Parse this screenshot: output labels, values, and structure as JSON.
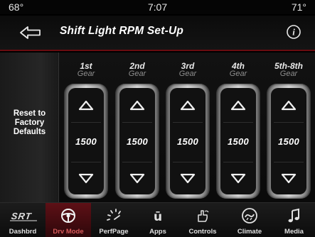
{
  "status": {
    "temp_left": "68°",
    "time": "7:07",
    "temp_right": "71°"
  },
  "header": {
    "title": "Shift Light RPM Set-Up",
    "back_icon": "back-arrow-icon",
    "info_icon": "info-icon"
  },
  "reset": {
    "label": "Reset to\nFactory\nDefaults"
  },
  "gears": [
    {
      "name": "1st",
      "sub": "Gear",
      "value": "1500"
    },
    {
      "name": "2nd",
      "sub": "Gear",
      "value": "1500"
    },
    {
      "name": "3rd",
      "sub": "Gear",
      "value": "1500"
    },
    {
      "name": "4th",
      "sub": "Gear",
      "value": "1500"
    },
    {
      "name": "5th-8th",
      "sub": "Gear",
      "value": "1500"
    }
  ],
  "nav": [
    {
      "label": "Dashbrd",
      "icon": "srt-logo-icon"
    },
    {
      "label": "Drv Mode",
      "icon": "steering-wheel-icon",
      "active": true
    },
    {
      "label": "PerfPage",
      "icon": "performance-gauge-icon"
    },
    {
      "label": "Apps",
      "icon": "apps-icon"
    },
    {
      "label": "Controls",
      "icon": "controls-hand-icon"
    },
    {
      "label": "Climate",
      "icon": "climate-icon"
    },
    {
      "label": "Media",
      "icon": "music-note-icon"
    }
  ],
  "colors": {
    "accent": "#6a0c10",
    "active_tab": "#5e1016",
    "active_label": "#d85a5a"
  }
}
